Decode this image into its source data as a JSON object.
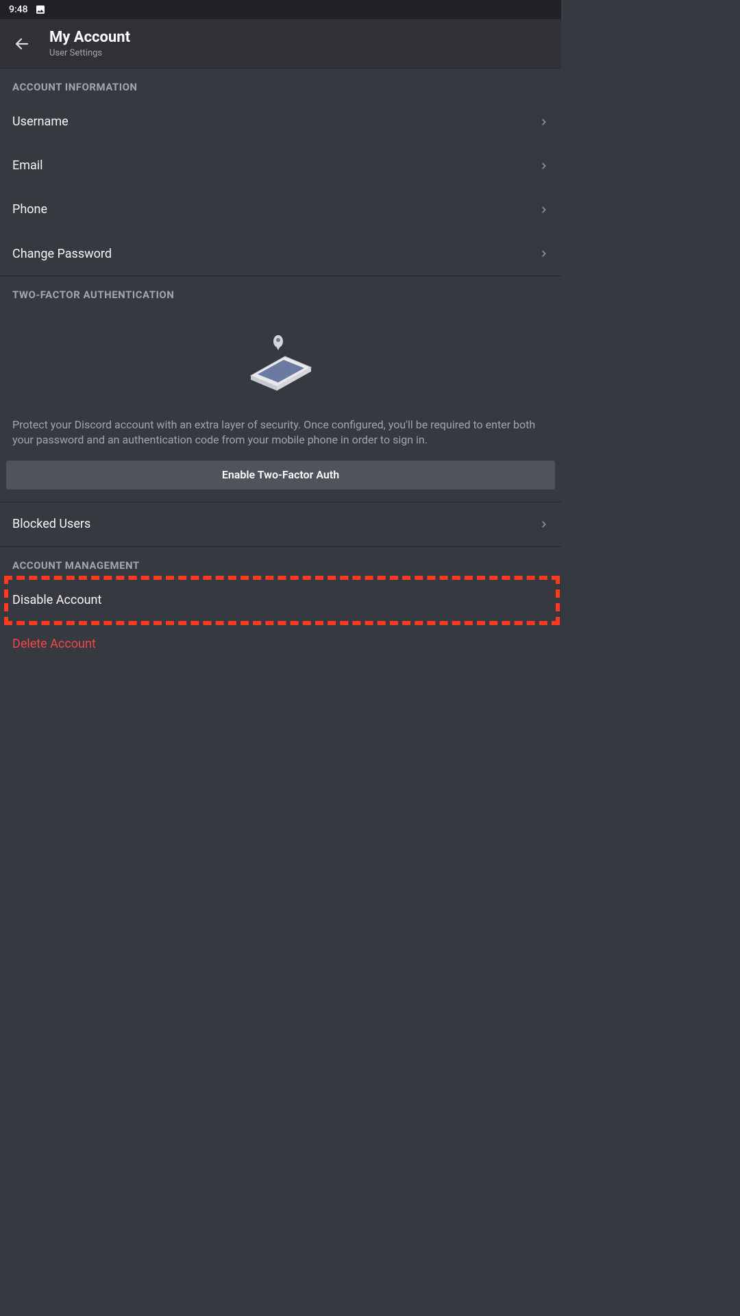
{
  "statusbar": {
    "time": "9:48"
  },
  "header": {
    "title": "My Account",
    "subtitle": "User Settings"
  },
  "sections": {
    "account_info": {
      "label": "ACCOUNT INFORMATION",
      "items": {
        "username": "Username",
        "email": "Email",
        "phone": "Phone",
        "change_password": "Change Password"
      }
    },
    "tfa": {
      "label": "TWO-FACTOR AUTHENTICATION",
      "description": "Protect your Discord account with an extra layer of security. Once configured, you'll be required to enter both your password and an authentication code from your mobile phone in order to sign in.",
      "button": "Enable Two-Factor Auth"
    },
    "blocked_users": "Blocked Users",
    "account_management": {
      "label": "ACCOUNT MANAGEMENT",
      "disable": "Disable Account",
      "delete": "Delete Account"
    }
  }
}
